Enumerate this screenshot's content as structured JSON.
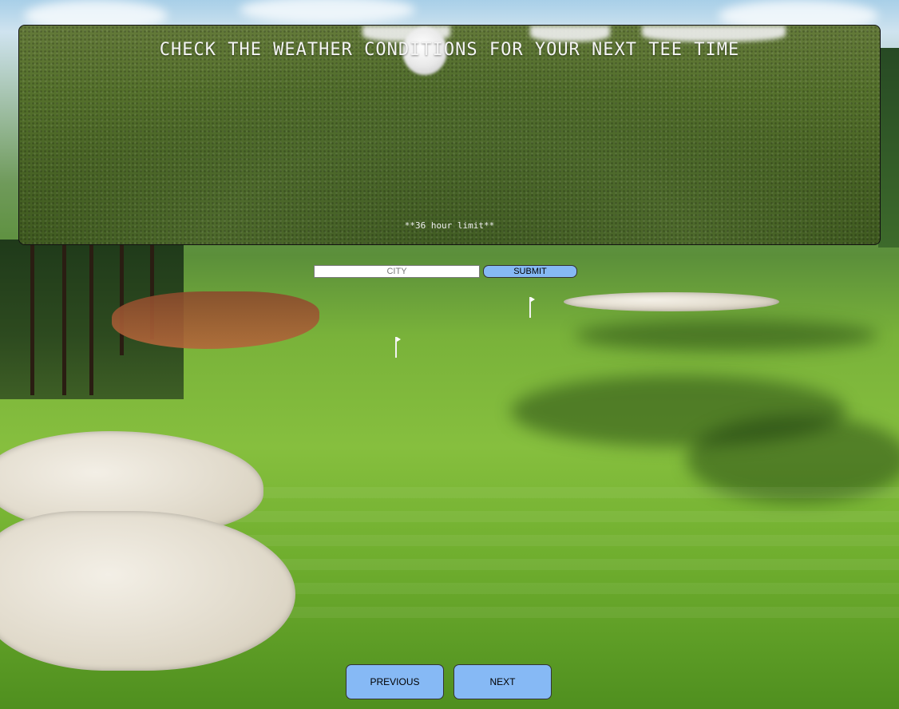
{
  "hero": {
    "title": "CHECK THE WEATHER CONDITIONS FOR YOUR NEXT TEE TIME",
    "note": "**36 hour limit**"
  },
  "form": {
    "city_placeholder": "CITY",
    "city_value": "",
    "submit_label": "SUBMIT"
  },
  "navigation": {
    "previous_label": "PREVIOUS",
    "next_label": "NEXT"
  },
  "colors": {
    "button_fill": "#86b9f5",
    "title_text": "#f4f4f4"
  }
}
